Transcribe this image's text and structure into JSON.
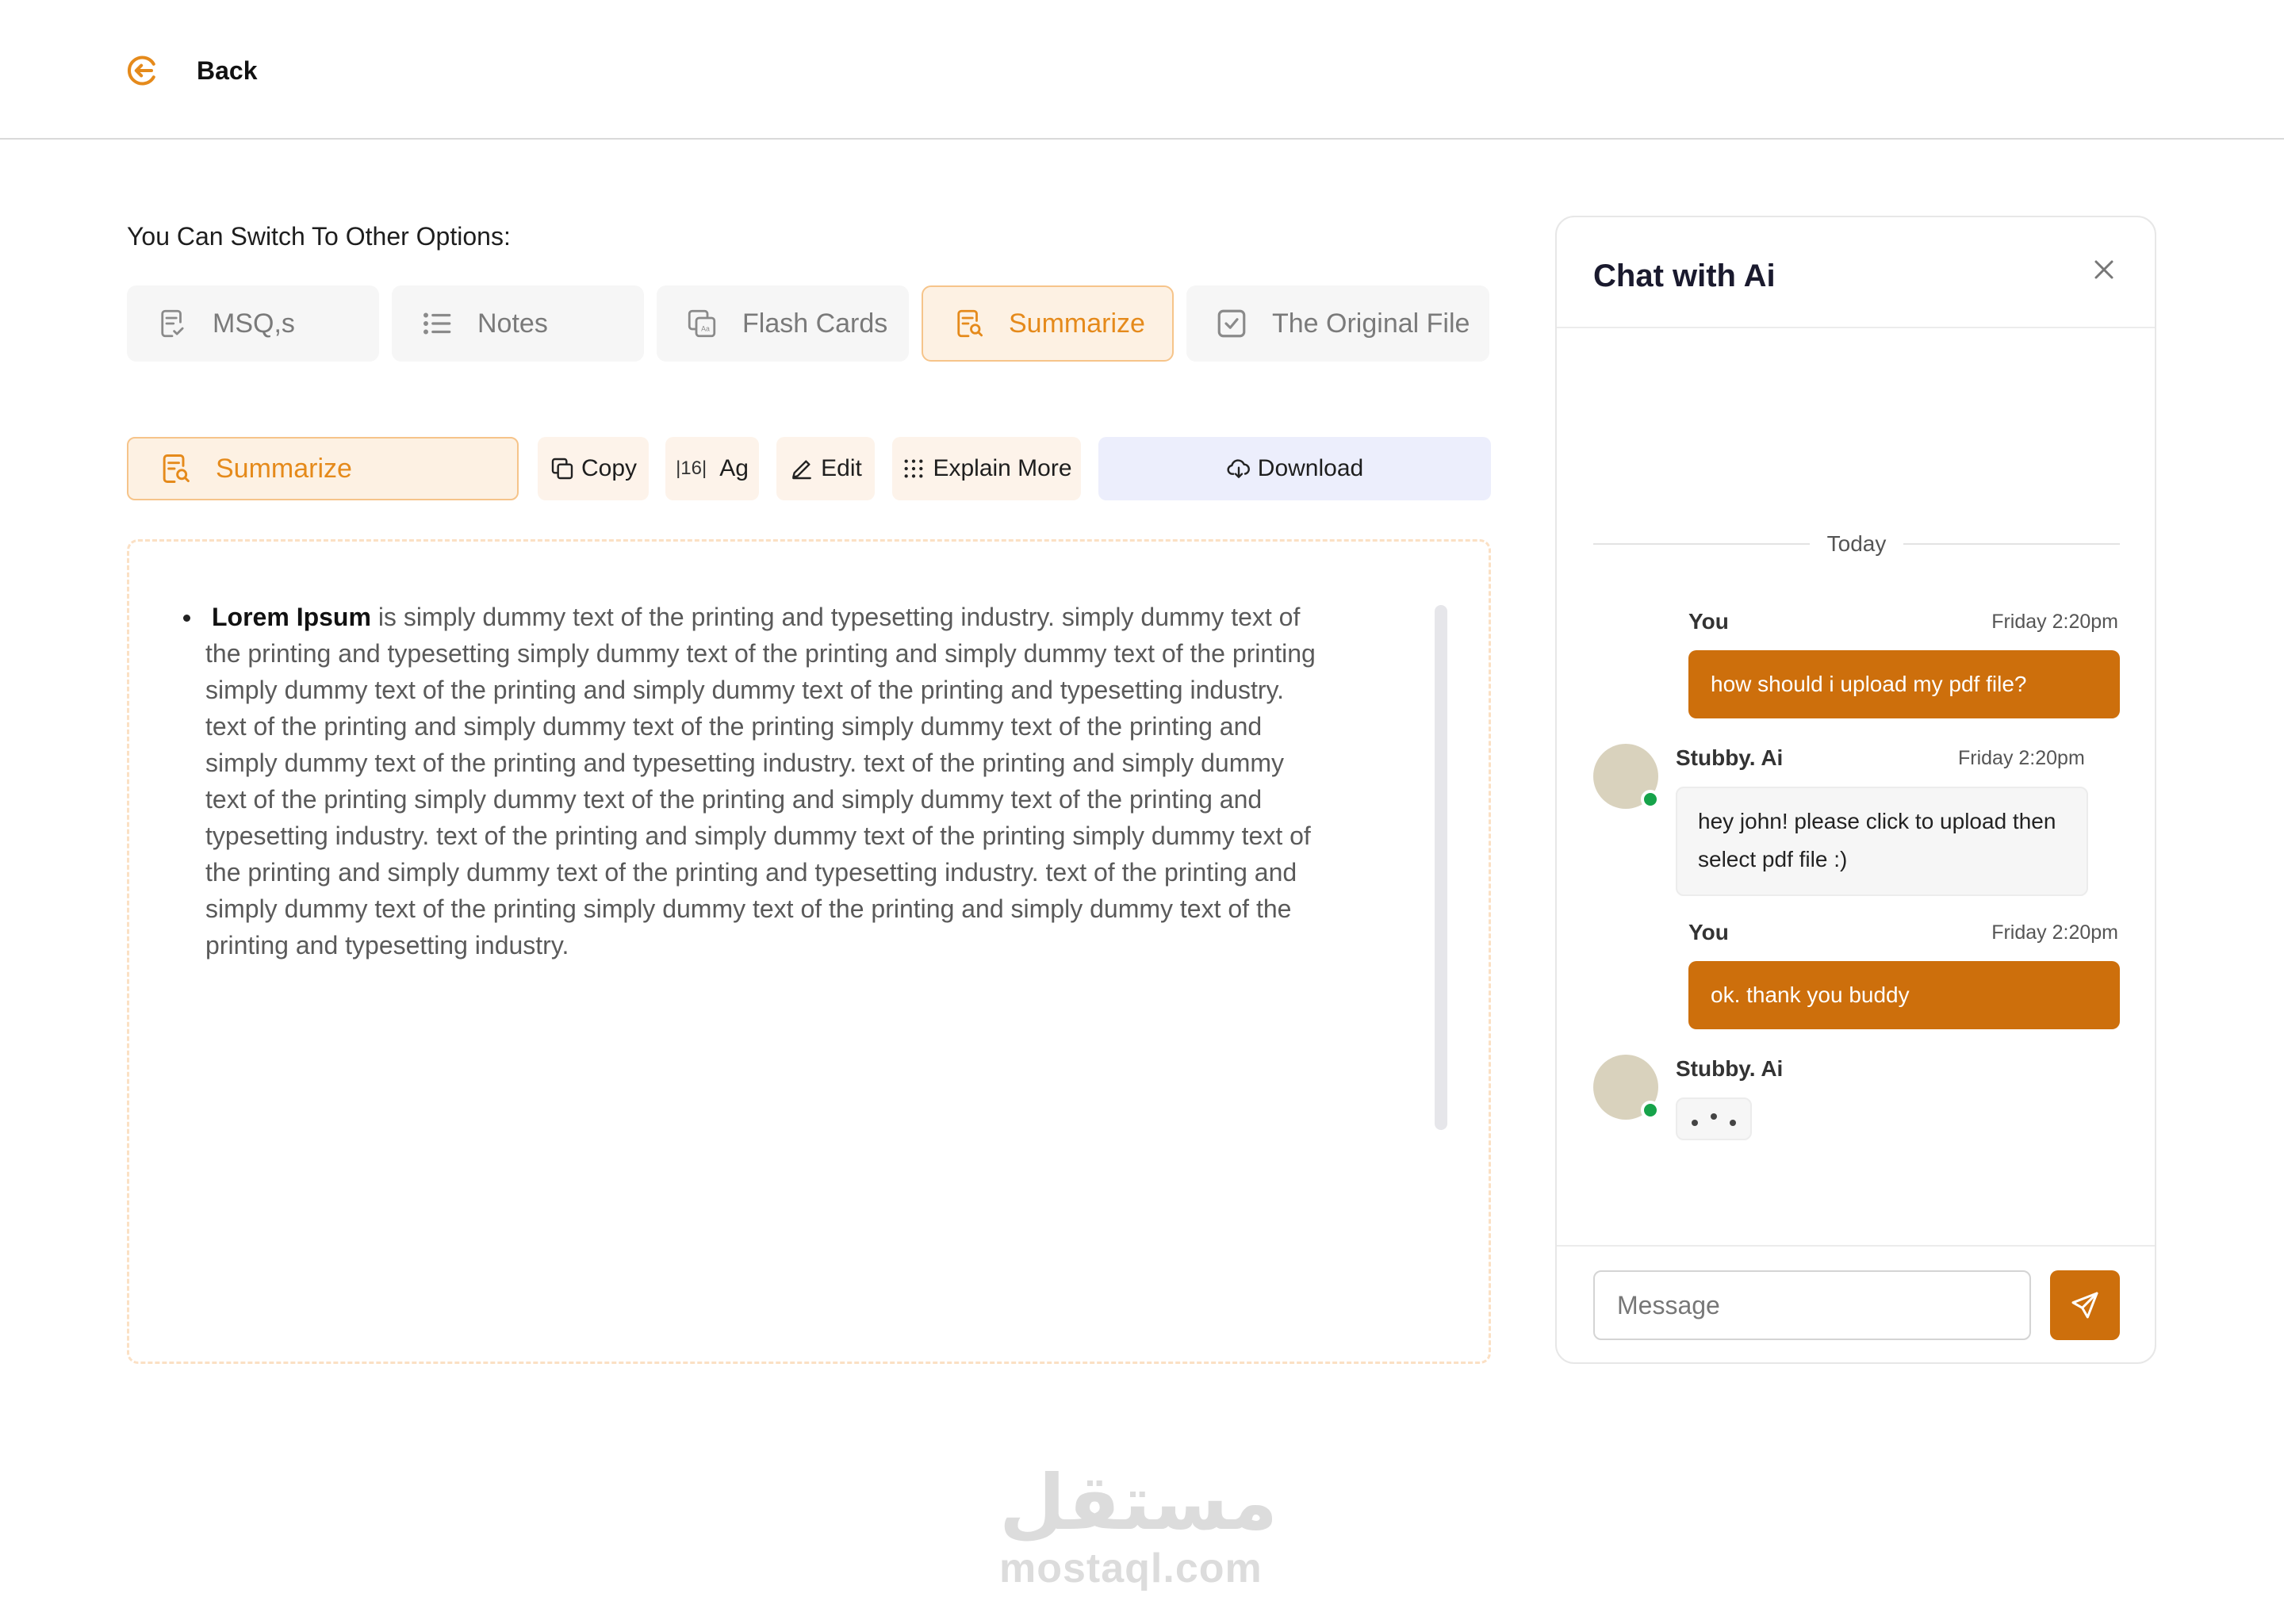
{
  "header": {
    "back_label": "Back"
  },
  "switch_title": "You Can Switch To Other Options:",
  "tabs": [
    {
      "label": "MSQ,s",
      "icon": "checklist-doc-icon",
      "active": false
    },
    {
      "label": "Notes",
      "icon": "list-icon",
      "active": false
    },
    {
      "label": "Flash Cards",
      "icon": "flash-cards-icon",
      "active": false
    },
    {
      "label": "Summarize",
      "icon": "summarize-doc-icon",
      "active": true
    },
    {
      "label": "The Original File",
      "icon": "checkbox-icon",
      "active": false
    }
  ],
  "toolbar": {
    "summarize_label": "Summarize",
    "copy_label": "Copy",
    "font_size": "16",
    "font_label": "Ag",
    "edit_label": "Edit",
    "explain_label": "Explain More",
    "download_label": "Download"
  },
  "content": {
    "lead": "Lorem Ipsum",
    "body": " is simply dummy text of the printing and typesetting industry. simply dummy text of the printing and typesetting simply dummy text of the printing and simply dummy text of the printing simply dummy text of the printing and simply dummy text of the printing and typesetting industry. text of the printing and simply dummy text of the printing simply dummy text of the printing and simply dummy text of the printing and typesetting industry. text of the printing and simply dummy text of the printing simply dummy text of the printing and simply dummy text of the printing and typesetting industry. text of the printing and simply dummy text of the printing simply dummy text of the printing and simply dummy text of the printing and typesetting industry. text of the printing and simply dummy text of the printing simply dummy text of the printing and simply dummy text of the printing and typesetting industry."
  },
  "chat": {
    "title": "Chat with Ai",
    "divider": "Today",
    "messages": [
      {
        "sender": "You",
        "time": "Friday 2:20pm",
        "text": "how should i upload my pdf file?"
      },
      {
        "sender": "Stubby. Ai",
        "time": "Friday 2:20pm",
        "text": "hey john! please click to upload then select pdf file :)"
      },
      {
        "sender": "You",
        "time": "Friday 2:20pm",
        "text": "ok. thank you buddy"
      },
      {
        "sender": "Stubby. Ai",
        "time": "",
        "text": ""
      }
    ],
    "input_placeholder": "Message"
  },
  "watermark": {
    "arabic": "مستقل",
    "latin": "mostaql.com"
  },
  "colors": {
    "accent": "#e58a1b",
    "accent_dark": "#cd6f0c",
    "active_bg": "#fdf1e3",
    "download_bg": "#eceefc",
    "online": "#16a34a"
  }
}
